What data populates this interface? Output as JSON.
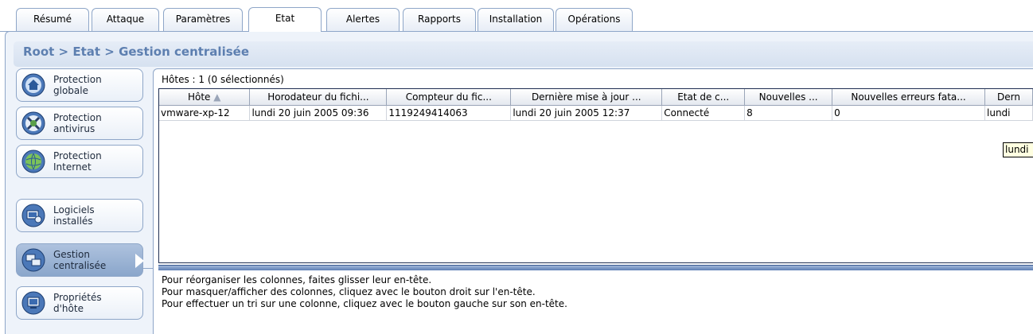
{
  "tabs": [
    {
      "label": "Résumé"
    },
    {
      "label": "Attaque"
    },
    {
      "label": "Paramètres"
    },
    {
      "label": "Etat"
    },
    {
      "label": "Alertes"
    },
    {
      "label": "Rapports"
    },
    {
      "label": "Installation"
    },
    {
      "label": "Opérations"
    }
  ],
  "active_tab": "Etat",
  "breadcrumb": "Root > Etat > Gestion centralisée",
  "sidebar": {
    "items": [
      {
        "label": "Protection\nglobale",
        "icon": "home-icon"
      },
      {
        "label": "Protection\nantivirus",
        "icon": "antivirus-icon"
      },
      {
        "label": "Protection\nInternet",
        "icon": "globe-icon"
      },
      {
        "label": "Logiciels\ninstallés",
        "icon": "software-icon"
      },
      {
        "label": "Gestion\ncentralisée",
        "icon": "management-icon"
      },
      {
        "label": "Propriétés\nd'hôte",
        "icon": "host-properties-icon"
      }
    ],
    "active_index": 4
  },
  "hosts": {
    "count_label": "Hôtes : 1 (0 sélectionnés)",
    "columns": [
      "Hôte",
      "Horodateur du fichi...",
      "Compteur du fic...",
      "Dernière mise à jour ...",
      "Etat de c...",
      "Nouvelles ...",
      "Nouvelles erreurs fata...",
      "Dern"
    ],
    "rows": [
      [
        "vmware-xp-12",
        "lundi 20 juin 2005 09:36",
        "1119249414063",
        "lundi 20 juin 2005 12:37",
        "Connecté",
        "8",
        "0",
        "lundi"
      ]
    ],
    "tooltip": "lundi"
  },
  "help_lines": [
    "Pour réorganiser les colonnes, faites glisser leur en-tête.",
    "Pour masquer/afficher des colonnes, cliquez avec le bouton droit sur l'en-tête.",
    "Pour effectuer un tri sur une colonne, cliquez avec le bouton gauche sur son en-tête."
  ]
}
